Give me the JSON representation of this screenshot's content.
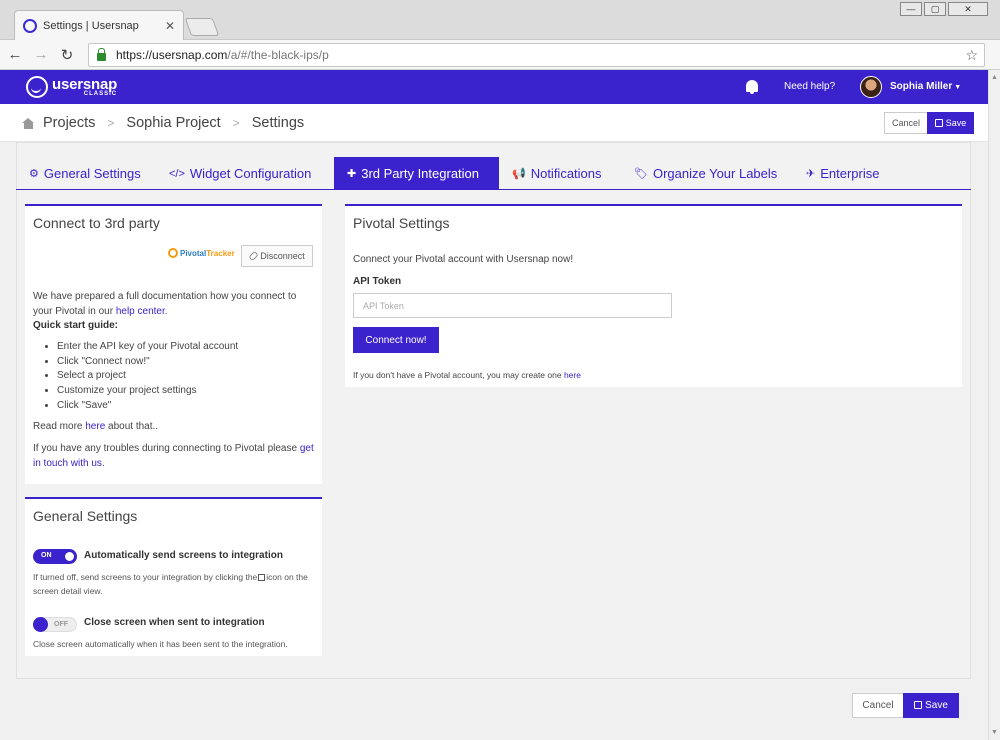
{
  "browser": {
    "tab_title": "Settings | Usersnap",
    "tab_close": "✕",
    "url_host": "https://usersnap.com",
    "url_path": "/a/#/the-black-ips/p",
    "window_min": "—",
    "window_max": "▢",
    "window_close": "✕"
  },
  "header": {
    "logo_name": "usersnap",
    "logo_sub": "CLASSIC",
    "help": "Need help?",
    "user": "Sophia Miller"
  },
  "breadcrumb": {
    "items": [
      "Projects",
      "Sophia Project",
      "Settings"
    ],
    "separator": ">"
  },
  "actions": {
    "cancel": "Cancel",
    "save": "Save"
  },
  "tabs": [
    {
      "label": "General Settings",
      "icon": "gear-icon",
      "glyph": "⚙"
    },
    {
      "label": "Widget Configuration",
      "icon": "code-icon",
      "glyph": "</>"
    },
    {
      "label": "3rd Party Integration",
      "icon": "puzzle-icon",
      "glyph": "✚"
    },
    {
      "label": "Notifications",
      "icon": "bullhorn-icon",
      "glyph": "📢"
    },
    {
      "label": "Organize Your Labels",
      "icon": "tags-icon",
      "glyph": "🏷"
    },
    {
      "label": "Enterprise",
      "icon": "plane-icon",
      "glyph": "✈"
    }
  ],
  "active_tab": "3rd Party Integration",
  "connect_panel": {
    "title": "Connect to 3rd party",
    "logo_part1": "Pivotal",
    "logo_part2": "Tracker",
    "disconnect": "Disconnect",
    "doc_text_1": "We have prepared a full documentation how you connect to your Pivotal in our ",
    "doc_link": "help center",
    "doc_text_2": ".",
    "guide_title": "Quick start guide:",
    "guide": [
      "Enter the API key of your Pivotal account",
      "Click \"Connect now!\"",
      "Select a project",
      "Customize your project settings",
      "Click \"Save\""
    ],
    "read_more_1": "Read more ",
    "read_more_link": "here",
    "read_more_2": " about that..",
    "trouble_text": "If you have any troubles during connecting to Pivotal please ",
    "trouble_link": "get in touch with us",
    "trouble_end": "."
  },
  "general_panel": {
    "title": "General Settings",
    "toggle1_state": "ON",
    "toggle1_label": "Automatically send screens to integration",
    "toggle1_desc_1": "If turned off, send screens to your integration by clicking the",
    "toggle1_desc_2": "icon on the screen detail view.",
    "toggle2_state": "OFF",
    "toggle2_label": "Close screen when sent to integration",
    "toggle2_desc": "Close screen automatically when it has been sent to the integration."
  },
  "pivotal_panel": {
    "title": "Pivotal Settings",
    "intro": "Connect your Pivotal account with Usersnap now!",
    "token_label": "API Token",
    "token_placeholder": "API Token",
    "connect_button": "Connect now!",
    "footer_text": "If you don't have a Pivotal account, you may create one ",
    "footer_link": "here"
  },
  "colors": {
    "brand": "#3a22cc"
  }
}
